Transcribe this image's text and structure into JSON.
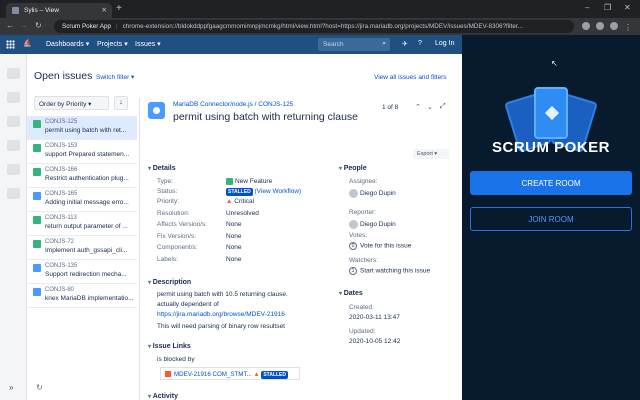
{
  "browser": {
    "tab_title": "Sylis – View",
    "new_tab": "+",
    "app_name": "Scrum Poker App",
    "url": "chrome-extension://bldokddppfgaagcmmomimnpjmcmkg/html/view.html?host=https://jira.mariadb.org/projects/MDEV/issues/MDEV-8306?filter...",
    "win_minimize": "–",
    "win_maximize": "❐",
    "win_close": "✕"
  },
  "jira_nav": {
    "dashboards": "Dashboards ▾",
    "projects": "Projects ▾",
    "issues": "Issues ▾",
    "search_placeholder": "Search",
    "login": "Log In"
  },
  "issues_list": {
    "title": "Open issues",
    "switch_filter": "Switch filter ▾",
    "view_all": "View all issues and filters",
    "order_by": "Order by Priority ▾",
    "order_dir": "↓",
    "items": [
      {
        "key": "CONJS-125",
        "summary": "permit using batch with ret...",
        "type": "story"
      },
      {
        "key": "CONJS-153",
        "summary": "support Prepared statemen...",
        "type": "story"
      },
      {
        "key": "CONJS-166",
        "summary": "Restrict authentication plug...",
        "type": "story"
      },
      {
        "key": "CONJS-165",
        "summary": "Adding initial message erro...",
        "type": "task"
      },
      {
        "key": "CONJS-113",
        "summary": "return output parameter of ...",
        "type": "story"
      },
      {
        "key": "CONJS-72",
        "summary": "Implement auth_gssapi_cli...",
        "type": "story"
      },
      {
        "key": "CONJS-135",
        "summary": "Support redirection mecha...",
        "type": "task"
      },
      {
        "key": "CONJS-80",
        "summary": "knex MariaDB implementatio...",
        "type": "task"
      }
    ]
  },
  "issue": {
    "breadcrumb": "MariaDB Connector/node.js  /  CONJS-125",
    "title": "permit using batch with returning clause",
    "pager": "1 of 8",
    "export": "Export ▾",
    "details_heading": "Details",
    "fields": {
      "type_label": "Type:",
      "type_value": "New Feature",
      "status_label": "Status:",
      "status_value": "STALLED",
      "workflow": "(View Workflow)",
      "priority_label": "Priority:",
      "priority_value": "Critical",
      "resolution_label": "Resolution:",
      "resolution_value": "Unresolved",
      "affects_label": "Affects Version/s:",
      "affects_value": "None",
      "fix_label": "Fix Version/s:",
      "fix_value": "None",
      "component_label": "Component/s:",
      "component_value": "None",
      "labels_label": "Labels:",
      "labels_value": "None"
    },
    "description_heading": "Description",
    "description_line1": "permit using batch with 10.5 returning clause.",
    "description_line2": "actually dependent of",
    "description_link": "https://jira.mariadb.org/browse/MDEV-21916",
    "description_line3": "This will need parsing of binary row resultset",
    "links_heading": "Issue Links",
    "blocked_by": "is blocked by",
    "link_item": "MDEV-21916  COM_STMT...",
    "link_status": "STALLED",
    "activity_heading": "Activity",
    "people_heading": "People",
    "assignee_label": "Assignee:",
    "assignee_value": "Diego Dupin",
    "reporter_label": "Reporter:",
    "reporter_value": "Diego Dupin",
    "votes_label": "Votes:",
    "votes_count": "0",
    "votes_value": "Vote for this issue",
    "watchers_label": "Watchers:",
    "watchers_count": "1",
    "watchers_value": "Start watching this issue",
    "dates_heading": "Dates",
    "created_label": "Created:",
    "created_value": "2020-03-11 13:47",
    "updated_label": "Updated:",
    "updated_value": "2020-10-05 12:42"
  },
  "scrum_panel": {
    "title": "SCRUM POKER",
    "create_room": "CREATE ROOM",
    "join_room": "JOIN ROOM",
    "create_color": "#1a73e8",
    "bg_color": "#081a2d"
  }
}
